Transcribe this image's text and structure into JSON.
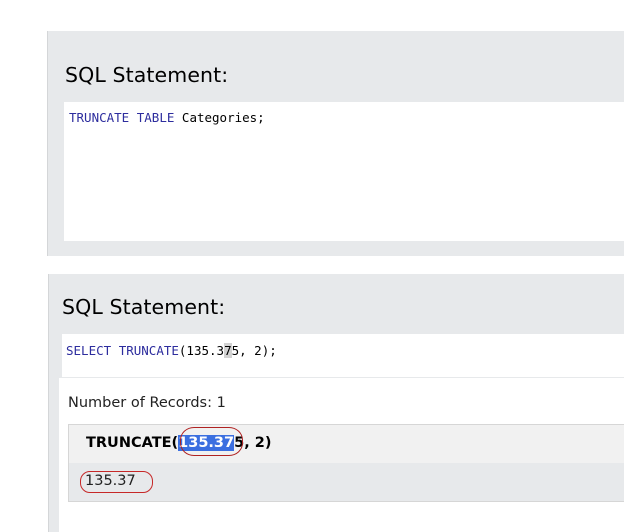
{
  "panel1": {
    "heading": "SQL Statement:",
    "code": {
      "kw1": "TRUNCATE",
      "sp1": " ",
      "kw2": "TABLE",
      "rest": " Categories;"
    }
  },
  "panel2": {
    "heading": "SQL Statement:",
    "code": {
      "kw1": "SELECT",
      "sp1": " ",
      "fn": "TRUNCATE",
      "pre": "(135.3",
      "hl": "7",
      "post": "5, 2);"
    },
    "result": {
      "records_label": "Number of Records: 1",
      "column_header": {
        "pre": "TRUNCATE(",
        "sel": "135.37",
        "post": "5, 2)"
      },
      "cell_value": "135.37"
    }
  },
  "colors": {
    "panel_bg": "#e7e9eb",
    "keyword": "#2d2d9e",
    "selection": "#3b6fe0",
    "annotation": "#c62828"
  }
}
